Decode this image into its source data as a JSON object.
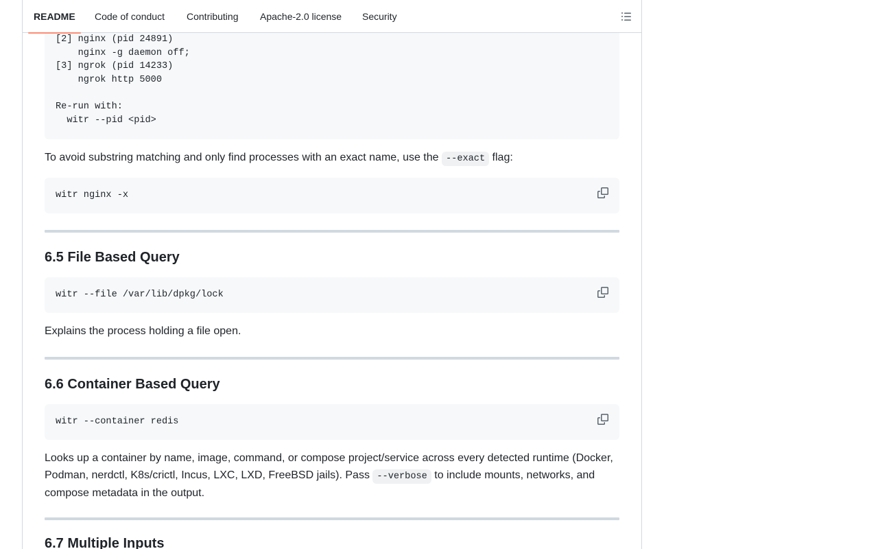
{
  "tabs": [
    {
      "label": "README",
      "active": true
    },
    {
      "label": "Code of conduct",
      "active": false
    },
    {
      "label": "Contributing",
      "active": false
    },
    {
      "label": "Apache-2.0 license",
      "active": false
    },
    {
      "label": "Security",
      "active": false
    }
  ],
  "outline_icon": "list-unordered-icon",
  "copy_icon": "copy-icon",
  "accent_color": "#fd8c73",
  "blocks": {
    "process_list": "[2] nginx (pid 24891)\n    nginx -g daemon off;\n[3] ngrok (pid 14233)\n    ngrok http 5000\n\nRe-run with:\n  witr --pid <pid>",
    "exact_para_before": "To avoid substring matching and only find processes with an exact name, use the ",
    "exact_code": "--exact",
    "exact_para_after": " flag:",
    "exact_command": "witr nginx -x",
    "file_heading": "6.5 File Based Query",
    "file_command": "witr --file /var/lib/dpkg/lock",
    "file_para": "Explains the process holding a file open.",
    "container_heading": "6.6 Container Based Query",
    "container_command": "witr --container redis",
    "container_para_before": "Looks up a container by name, image, command, or compose project/service across every detected runtime (Docker, Podman, nerdctl, K8s/crictl, Incus, LXC, LXD, FreeBSD jails). Pass ",
    "container_code": "--verbose",
    "container_para_after": " to include mounts, networks, and compose metadata in the output.",
    "multi_heading": "6.7 Multiple Inputs"
  }
}
